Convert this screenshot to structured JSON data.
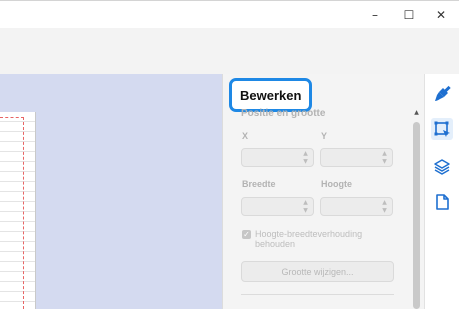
{
  "window": {
    "minimize_glyph": "–",
    "maximize_glyph": "☐",
    "close_glyph": "✕"
  },
  "panel": {
    "title": "Bewerken",
    "section_heading": "Positie en grootte",
    "x_label": "X",
    "y_label": "Y",
    "width_label": "Breedte",
    "height_label": "Hoogte",
    "keep_aspect_label": "Hoogte-breedteverhouding behouden",
    "keep_aspect_checked": true,
    "resize_button_label": "Grootte wijzigen..."
  },
  "sidebar": {
    "icons": [
      "paint-brush-icon",
      "transform-icon",
      "layers-icon",
      "page-icon"
    ],
    "active": "transform-icon"
  },
  "colors": {
    "accent": "#1e88e5",
    "canvas_background": "#d4daf0",
    "panel_background": "#f4f4f4",
    "disabled_text": "#b3b3b3"
  }
}
